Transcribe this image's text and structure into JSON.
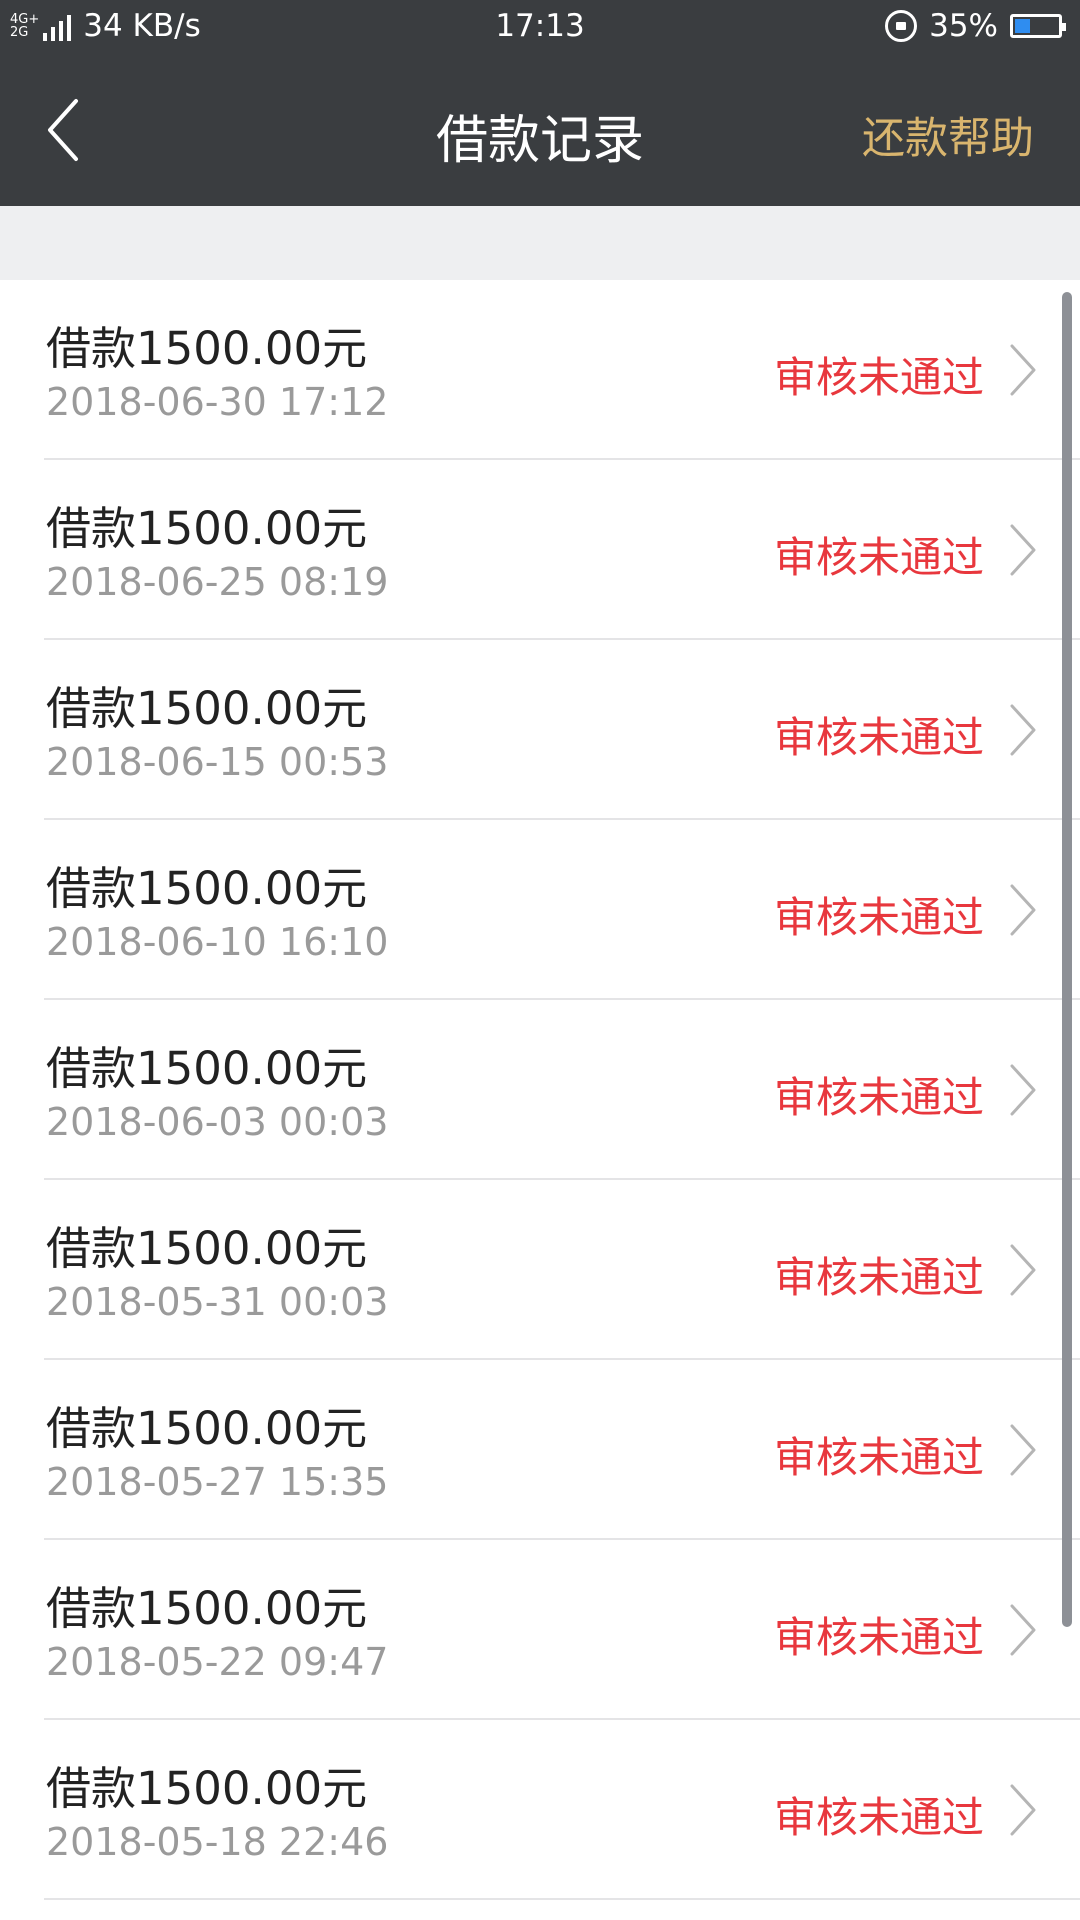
{
  "status_bar": {
    "network_top": "4G+",
    "network_bottom": "2G",
    "speed": "34 KB/s",
    "time": "17:13",
    "battery": "35%",
    "battery_level": 0.35
  },
  "header": {
    "title": "借款记录",
    "help_label": "还款帮助"
  },
  "records": [
    {
      "amount": "借款1500.00元",
      "date": "2018-06-30 17:12",
      "status": "审核未通过"
    },
    {
      "amount": "借款1500.00元",
      "date": "2018-06-25 08:19",
      "status": "审核未通过"
    },
    {
      "amount": "借款1500.00元",
      "date": "2018-06-15 00:53",
      "status": "审核未通过"
    },
    {
      "amount": "借款1500.00元",
      "date": "2018-06-10 16:10",
      "status": "审核未通过"
    },
    {
      "amount": "借款1500.00元",
      "date": "2018-06-03 00:03",
      "status": "审核未通过"
    },
    {
      "amount": "借款1500.00元",
      "date": "2018-05-31 00:03",
      "status": "审核未通过"
    },
    {
      "amount": "借款1500.00元",
      "date": "2018-05-27 15:35",
      "status": "审核未通过"
    },
    {
      "amount": "借款1500.00元",
      "date": "2018-05-22 09:47",
      "status": "审核未通过"
    },
    {
      "amount": "借款1500.00元",
      "date": "2018-05-18 22:46",
      "status": "审核未通过"
    }
  ],
  "colors": {
    "header_bg": "#3a3d40",
    "help_link": "#d9b56e",
    "status_rejected": "#e8373d",
    "date_text": "#9a9a9a"
  }
}
